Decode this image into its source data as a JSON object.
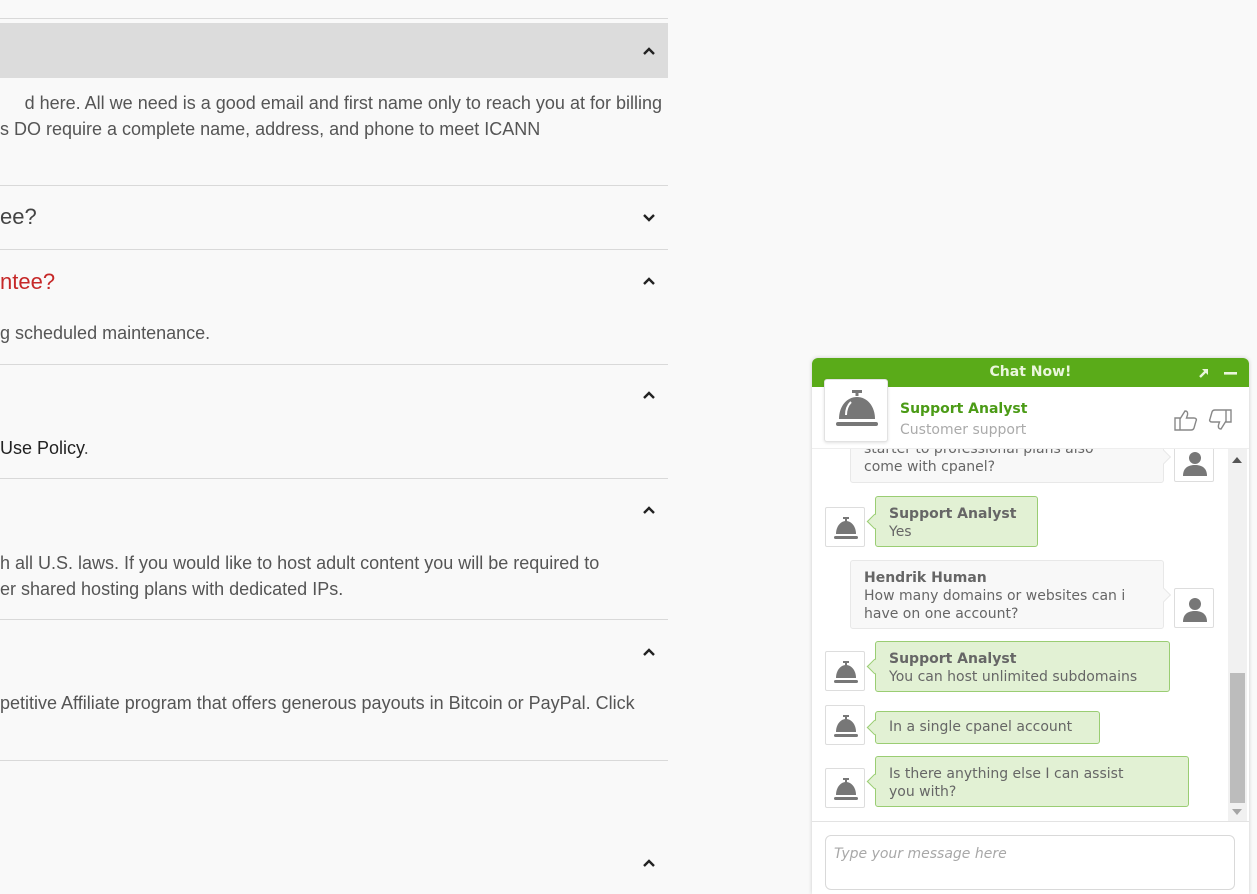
{
  "faq": {
    "items": [
      {
        "title": "",
        "state": "expanded",
        "highlighted": true,
        "body_lines": [
          "d here. All we need is a good email and first name only to reach you at for billing",
          "s DO require a complete name, address, and phone to meet ICANN"
        ]
      },
      {
        "title": "ee?",
        "state": "collapsed",
        "highlighted": false,
        "body_lines": []
      },
      {
        "title": "ntee?",
        "state": "expanded",
        "active_color": "#c62828",
        "body_lines": [
          "g scheduled maintenance."
        ]
      },
      {
        "title": "",
        "state": "expanded",
        "body_lines": [],
        "body_link": "Use Policy",
        "body_suffix": "."
      },
      {
        "title": "",
        "state": "expanded",
        "body_lines": [
          "h all U.S. laws. If you would like to host adult content you will be required to",
          "er shared hosting plans with dedicated IPs."
        ]
      },
      {
        "title": "",
        "state": "expanded",
        "body_lines": [
          "petitive Affiliate program that offers generous payouts in Bitcoin or PayPal. Click"
        ]
      },
      {
        "title": "",
        "state": "expanded",
        "body_lines": []
      }
    ]
  },
  "chat": {
    "title": "Chat Now!",
    "brand_color": "#5aab19",
    "popout_icon": "arrow-up-right-icon",
    "minimize_icon": "minus-icon",
    "agent": {
      "name": "Support Analyst",
      "role": "Customer support",
      "avatar_icon": "service-bell-icon"
    },
    "rating": {
      "up_icon": "thumbs-up-icon",
      "down_icon": "thumbs-down-icon"
    },
    "messages": [
      {
        "from": "user",
        "sender": "",
        "text_line1": "starter to professional plans also",
        "text_line2": "come with cpanel?"
      },
      {
        "from": "agent",
        "sender": "Support Analyst",
        "text": "Yes"
      },
      {
        "from": "user",
        "sender": "Hendrik Human",
        "text_line1": "How many domains or websites can i",
        "text_line2": "have on one account?"
      },
      {
        "from": "agent",
        "sender": "Support Analyst",
        "text": "You can host unlimited subdomains"
      },
      {
        "from": "agent",
        "sender": "",
        "text": "In a single cpanel account"
      },
      {
        "from": "agent",
        "sender": "",
        "text_line1": "Is there anything else I can assist",
        "text_line2": "you with?"
      }
    ],
    "scroll_position_percent": 100,
    "input": {
      "value": "",
      "placeholder": "Type your message here"
    }
  }
}
